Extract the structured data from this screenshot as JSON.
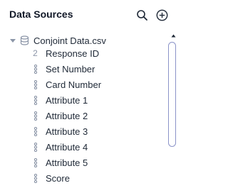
{
  "header": {
    "title": "Data Sources",
    "search_icon": "search-icon",
    "add_icon": "add-circle-icon"
  },
  "tree": {
    "root": {
      "label": "Conjoint Data.csv",
      "icon": "database-icon",
      "expanded": true
    },
    "fields": [
      {
        "label": "Response ID",
        "type_icon": "2"
      },
      {
        "label": "Set Number",
        "type_icon": "categorical-icon"
      },
      {
        "label": "Card Number",
        "type_icon": "categorical-icon"
      },
      {
        "label": "Attribute 1",
        "type_icon": "categorical-icon"
      },
      {
        "label": "Attribute 2",
        "type_icon": "categorical-icon"
      },
      {
        "label": "Attribute 3",
        "type_icon": "categorical-icon"
      },
      {
        "label": "Attribute 4",
        "type_icon": "categorical-icon"
      },
      {
        "label": "Attribute 5",
        "type_icon": "categorical-icon"
      },
      {
        "label": "Score",
        "type_icon": "categorical-icon"
      }
    ]
  },
  "colors": {
    "text": "#1f2937",
    "icon_gray": "#8b95a7",
    "scrollbar": "#8b93c8"
  }
}
